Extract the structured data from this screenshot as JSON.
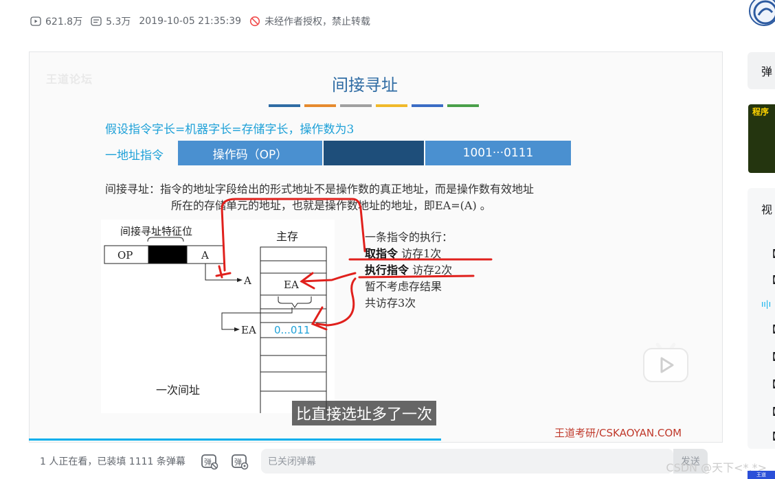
{
  "meta": {
    "plays": "621.8万",
    "danmaku_count": "5.3万",
    "datetime": "2019-10-05 21:35:39",
    "copyright": "未经作者授权，禁止转载"
  },
  "slide": {
    "watermark": "王道论坛",
    "title": "间接寻址",
    "assumption": "假设指令字长=机器字长=存储字长，操作数为3",
    "instr_label": "一地址指令",
    "opcode": "操作码（OP）",
    "address": "1001···0111",
    "desc_line1": "间接寻址：指令的地址字段给出的形式地址不是操作数的真正地址，而是操作数有效地址",
    "desc_line2": "所在的存储单元的地址，也就是操作数地址的地址，即EA=(A) 。",
    "diagram": {
      "feature_label": "间接寻址特征位",
      "op": "OP",
      "a": "A",
      "memory": "主存",
      "arrow_a": "A",
      "cell_ea": "EA",
      "arrow_ea": "EA",
      "cell_value": "0...011",
      "caption": "一次间址"
    },
    "exec": {
      "heading": "一条指令的执行：",
      "fetch_bold": "取指令",
      "fetch_rest": " 访存1次",
      "execute_bold": "执行指令",
      "execute_rest": " 访存2次",
      "note": "暂不考虑存结果",
      "total": "共访存3次"
    },
    "subtitle": "比直接选址多了一次",
    "brand": "王道考研/CSKAOYAN.COM"
  },
  "player": {
    "progress": 0.594
  },
  "danmaku_bar": {
    "watching": "1 人正在看，已装填 1111 条弹幕",
    "input_placeholder": "已关闭弹幕",
    "send": "发送"
  },
  "sidebar": {
    "danmaku_panel": "弹",
    "thumb_tag": "程序",
    "list_title": "视"
  },
  "csdn_watermark": "CSDN @天下<*.*>",
  "colors": {
    "title_blue": "#2f6ca4",
    "accent_cyan": "#1fa1d8",
    "opcode_bg": "#4a90d0",
    "mid_bg": "#1e4e7a",
    "addr_bg": "#4a90d0",
    "annotation_red": "#e0201c",
    "progress": "#00aeec",
    "bars": [
      "#2f6ca4",
      "#e68a2e",
      "#a0a0a0",
      "#f0b92a",
      "#3a6cc4",
      "#4aa04a"
    ]
  }
}
